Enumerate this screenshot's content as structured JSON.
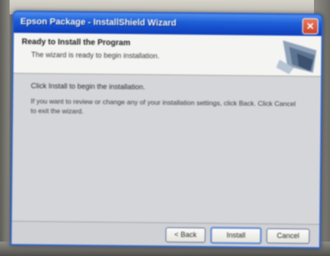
{
  "window": {
    "title": "Epson Package - InstallShield Wizard",
    "close_glyph": "✕"
  },
  "header": {
    "title": "Ready to Install the Program",
    "subtitle": "The wizard is ready to begin installation."
  },
  "body": {
    "lead": "Click Install to begin the installation.",
    "text": "If you want to review or change any of your installation settings, click Back. Click Cancel to exit the wizard."
  },
  "buttons": {
    "back": "< Back",
    "install": "Install",
    "cancel": "Cancel"
  },
  "colors": {
    "titlebar": "#1d5fd6",
    "close": "#c8452b",
    "dialog_bg": "#d5d6da"
  },
  "icons": {
    "close": "close-icon",
    "header_graphic": "installer-graphic-icon"
  }
}
